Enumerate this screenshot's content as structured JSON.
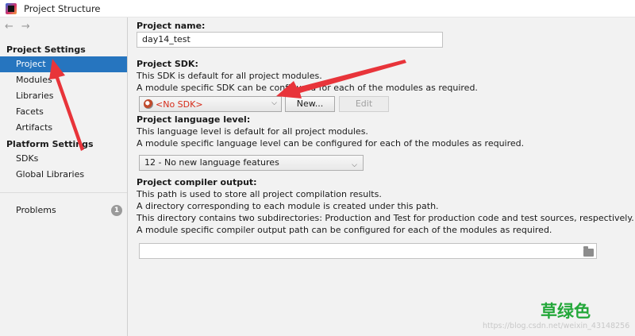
{
  "window": {
    "title": "Project Structure"
  },
  "nav": {
    "back": "←",
    "forward": "→"
  },
  "sidebar": {
    "project_settings_title": "Project Settings",
    "project_items": [
      "Project",
      "Modules",
      "Libraries",
      "Facets",
      "Artifacts"
    ],
    "platform_settings_title": "Platform Settings",
    "platform_items": [
      "SDKs",
      "Global Libraries"
    ],
    "problems_label": "Problems",
    "problems_count": "1",
    "selected": "Project"
  },
  "project_name": {
    "label": "Project name:",
    "value": "day14_test"
  },
  "project_sdk": {
    "label": "Project SDK:",
    "desc1": "This SDK is default for all project modules.",
    "desc2": "A module specific SDK can be configured for each of the modules as required.",
    "selected": "<No SDK>",
    "new_button": "New...",
    "edit_button": "Edit"
  },
  "language_level": {
    "label": "Project language level:",
    "desc1": "This language level is default for all project modules.",
    "desc2": "A module specific language level can be configured for each of the modules as required.",
    "selected": "12 - No new language features"
  },
  "compiler_output": {
    "label": "Project compiler output:",
    "desc1": "This path is used to store all project compilation results.",
    "desc2": "A directory corresponding to each module is created under this path.",
    "desc3": "This directory contains two subdirectories: Production and Test for production code and test sources, respectively.",
    "desc4": "A module specific compiler output path can be configured for each of the modules as required.",
    "value": ""
  },
  "annotations": {
    "color_note": "草绿色",
    "watermark": "https://blog.csdn.net/weixin_43148256"
  },
  "colors": {
    "selection": "#2675bf",
    "arrow": "#e8343a",
    "note": "#24a83a",
    "sdk_error": "#d62c1a"
  }
}
